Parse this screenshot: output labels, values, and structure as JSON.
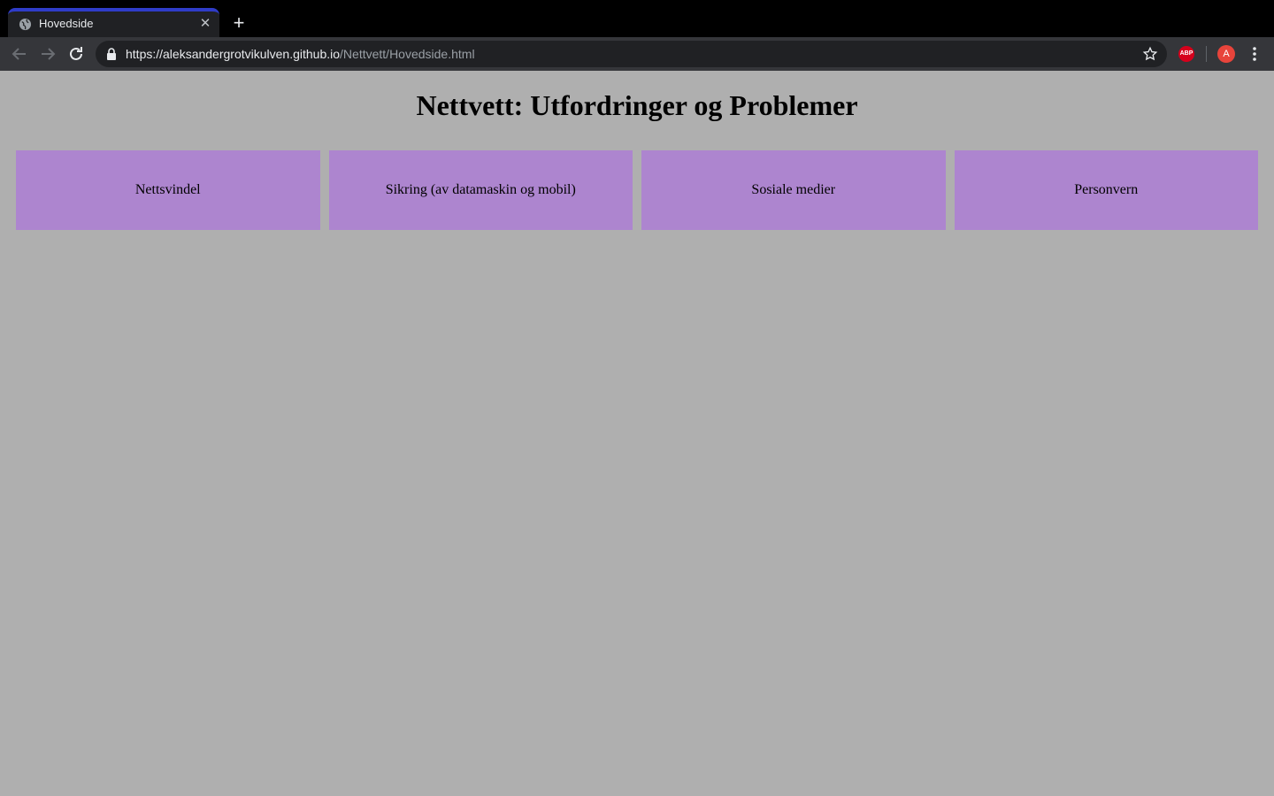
{
  "browser": {
    "tab": {
      "title": "Hovedside",
      "favicon": "globe-icon",
      "close_icon": "close-icon"
    },
    "new_tab_icon": "plus-icon",
    "url": {
      "host": "https://aleksandergrotvikulven.github.io",
      "path": "/Nettvett/Hovedside.html"
    },
    "extension_label": "ABP",
    "profile_initial": "A"
  },
  "page": {
    "title": "Nettvett: Utfordringer og Problemer",
    "cards": [
      {
        "label": "Nettsvindel"
      },
      {
        "label": "Sikring (av datamaskin og mobil)"
      },
      {
        "label": "Sosiale medier"
      },
      {
        "label": "Personvern"
      }
    ]
  },
  "colors": {
    "page_background": "#afafaf",
    "card_background": "#ad85cf",
    "tab_accent": "#2f3cc8"
  }
}
